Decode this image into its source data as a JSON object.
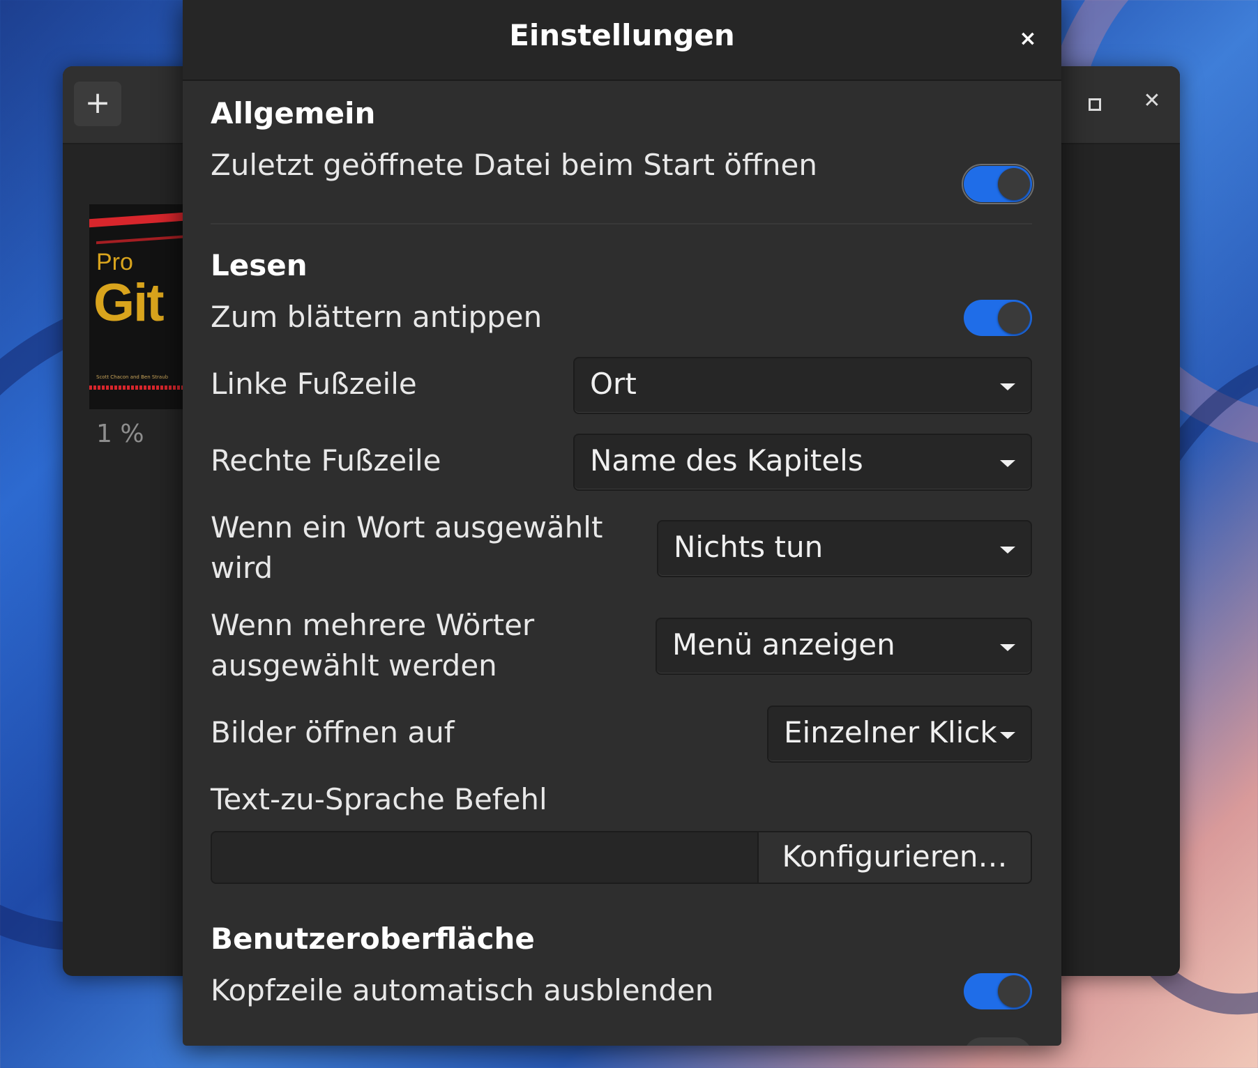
{
  "background_window": {
    "add_label": "+",
    "book": {
      "cover_pro": "Pro",
      "cover_title": "Git",
      "cover_authors": "Scott Chacon and Ben Straub"
    },
    "progress": "1 %"
  },
  "dialog": {
    "title": "Einstellungen",
    "close_glyph": "×",
    "sections": {
      "general": {
        "title": "Allgemein",
        "open_last_file": {
          "label": "Zuletzt geöffnete Datei beim Start öffnen",
          "enabled": true
        }
      },
      "reading": {
        "title": "Lesen",
        "tap_to_page": {
          "label": "Zum blättern antippen",
          "enabled": true
        },
        "left_footer": {
          "label": "Linke Fußzeile",
          "value": "Ort"
        },
        "right_footer": {
          "label": "Rechte Fußzeile",
          "value": "Name des Kapitels"
        },
        "word_selected": {
          "label": "Wenn ein Wort ausgewählt wird",
          "value": "Nichts tun"
        },
        "words_selected": {
          "label": "Wenn mehrere Wörter ausgewählt werden",
          "value": "Menü anzeigen"
        },
        "open_images": {
          "label": "Bilder öffnen auf",
          "value": "Einzelner Klick"
        },
        "tts": {
          "label": "Text-zu-Sprache Befehl",
          "value": "",
          "button": "Konfigurieren…"
        }
      },
      "interface": {
        "title": "Benutzeroberfläche",
        "autohide_header": {
          "label": "Kopfzeile automatisch ausblenden",
          "enabled": true
        }
      }
    }
  },
  "colors": {
    "accent": "#1f6de8",
    "dialog_bg": "#2e2e2e",
    "header_bg": "#262626"
  }
}
